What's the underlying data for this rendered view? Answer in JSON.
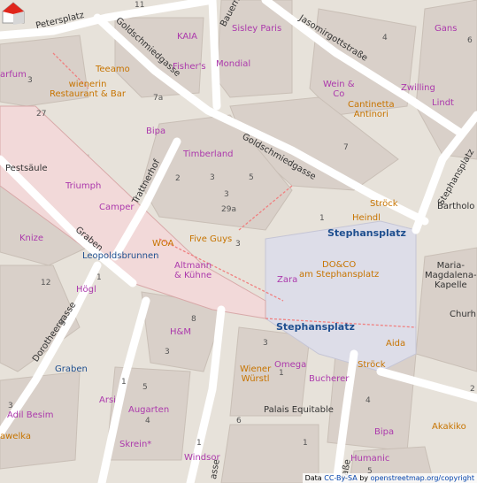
{
  "streets": {
    "petersplatz": "Petersplatz",
    "goldschmiedgasse_top": "Goldschmiedgasse",
    "goldschmiedgasse_mid": "Goldschmiedgasse",
    "bauernmarkt": "Bauernm",
    "jasomirgott": "Jasomirgottstraße",
    "trattnerhof": "Trattnerhof",
    "graben_street": "Graben",
    "dorotheergasse": "Dorotheergasse",
    "stephansplatz_street": "Stephansplatz",
    "tgasse": "asse",
    "rasse": "raße"
  },
  "places": {
    "stephansplatz_north": "Stephansplatz",
    "stephansplatz_south": "Stephansplatz",
    "leopoldsbrunnen": "Leopoldsbrunnen",
    "pestsaule": "Pestsäule",
    "graben": "Graben",
    "maria_magdalena": "Maria-\nMagdalena-\nKapelle",
    "palais_equitable": "Palais Equitable",
    "churh": "Churh",
    "bartholo": "Bartholo"
  },
  "pois": {
    "kaia": "KAIA",
    "sisley": "Sisley Paris",
    "gans": "Gans",
    "teeamo": "Teeamo",
    "fishers": "Fisher's",
    "mondial": "Mondial",
    "wien_co": "Wein &\nCo",
    "zwilling": "Zwilling",
    "parfum": "arfum",
    "wienerin": "wienerin\nRestaurant & Bar",
    "cantinetta": "Cantinetta\nAntinori",
    "lindt": "Lindt",
    "bipa_top": "Bipa",
    "timberland": "Timberland",
    "triumph": "Triumph",
    "camper": "Camper",
    "strock_top": "Ströck",
    "heindl": "Heindl",
    "woa": "WOA",
    "five_guys": "Five Guys",
    "knize": "Knize",
    "altmann": "Altmann\n& Kühne",
    "doco": "DO&CO\nam Stephansplatz",
    "zara": "Zara",
    "hogl": "Högl",
    "hm": "H&M",
    "aida": "Aida",
    "omega": "Omega",
    "wiener_wurstl": "Wiener\nWürstl",
    "strock_bottom": "Ströck",
    "bucherer": "Bucherer",
    "graben_shop": "Graben",
    "arsi": "Arsi",
    "adil": "Adil Besim",
    "augarten": "Augarten",
    "akakiko": "Akakiko",
    "bipa_bottom": "Bipa",
    "awelka": "awelka",
    "skrein": "Skrein*",
    "windsor": "Windsor",
    "humanic": "Humanic"
  },
  "house_numbers": [
    "11",
    "4",
    "6",
    "3",
    "7a",
    "27",
    "3",
    "5",
    "7",
    "2",
    "3",
    "29a",
    "1",
    "12",
    "1",
    "3",
    "8",
    "4",
    "3",
    "5",
    "1",
    "1",
    "3",
    "4",
    "3",
    "4",
    "6",
    "1",
    "1",
    "5",
    "2"
  ],
  "attribution": {
    "prefix": "Data ",
    "license": "CC-By-SA",
    "by": " by ",
    "osm": "openstreetmap.org/copyright"
  },
  "colors": {
    "background": "#eae5dc",
    "building": "#d9d0c9",
    "road": "#ffffff",
    "pedestrian": "#dddde8",
    "shop": "#ac39ac",
    "food": "#c77400",
    "label": "#1f4f8f"
  }
}
